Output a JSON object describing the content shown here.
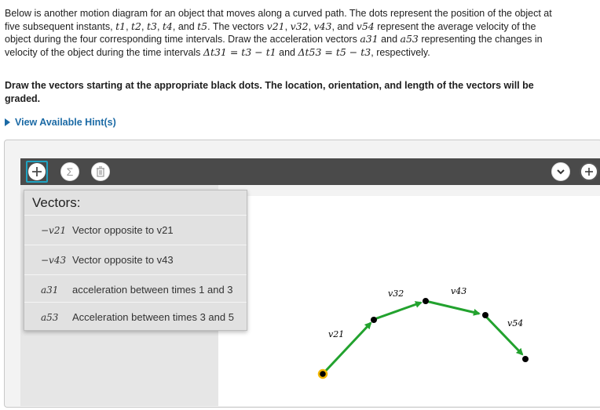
{
  "problem": {
    "intro": "Below is another motion diagram for an object that moves along a curved path. The dots represent the position of the object at five subsequent instants,",
    "t1": "t1",
    "t2": "t2",
    "t3": "t3",
    "t4": "t4",
    "t5": "t5",
    "vectors_sentence": "The vectors",
    "v21": "v21",
    "v32": "v32",
    "v43": "v43",
    "v54": "v54",
    "represent": "represent the average velocity of the object during the four corresponding time intervals. Draw the acceleration vectors",
    "a31": "a31",
    "a53": "a53",
    "representing": "representing the changes in velocity of the object during the time intervals",
    "dt31": "Δt31 = t3 − t1",
    "dt53": "Δt53 = t5 − t3",
    "respectively": "respectively."
  },
  "instruction": "Draw the vectors starting at the appropriate black dots. The location, orientation, and length of the vectors will be graded.",
  "hint_label": "View Available Hint(s)",
  "toolbar": {
    "add_icon": "plus-icon",
    "sum_icon": "sigma-icon",
    "delete_icon": "trash-icon",
    "chevron_icon": "chevron-down-icon",
    "accent": "#1fa3c2"
  },
  "vectors_menu": {
    "title": "Vectors:",
    "items": [
      {
        "symbol": "−v21",
        "label": "Vector opposite to v21"
      },
      {
        "symbol": "−v43",
        "label": "Vector opposite to v43"
      },
      {
        "symbol": "a31",
        "label": "acceleration between times 1 and 3"
      },
      {
        "symbol": "a53",
        "label": "Acceleration between times 3 and 5"
      }
    ]
  },
  "diagram": {
    "labels": {
      "v21": "v21",
      "v32": "v32",
      "v43": "v43",
      "v54": "v54"
    },
    "arrow_color": "#22a22e",
    "start_dot_color": "#f2b705",
    "dot_color": "#000000"
  }
}
